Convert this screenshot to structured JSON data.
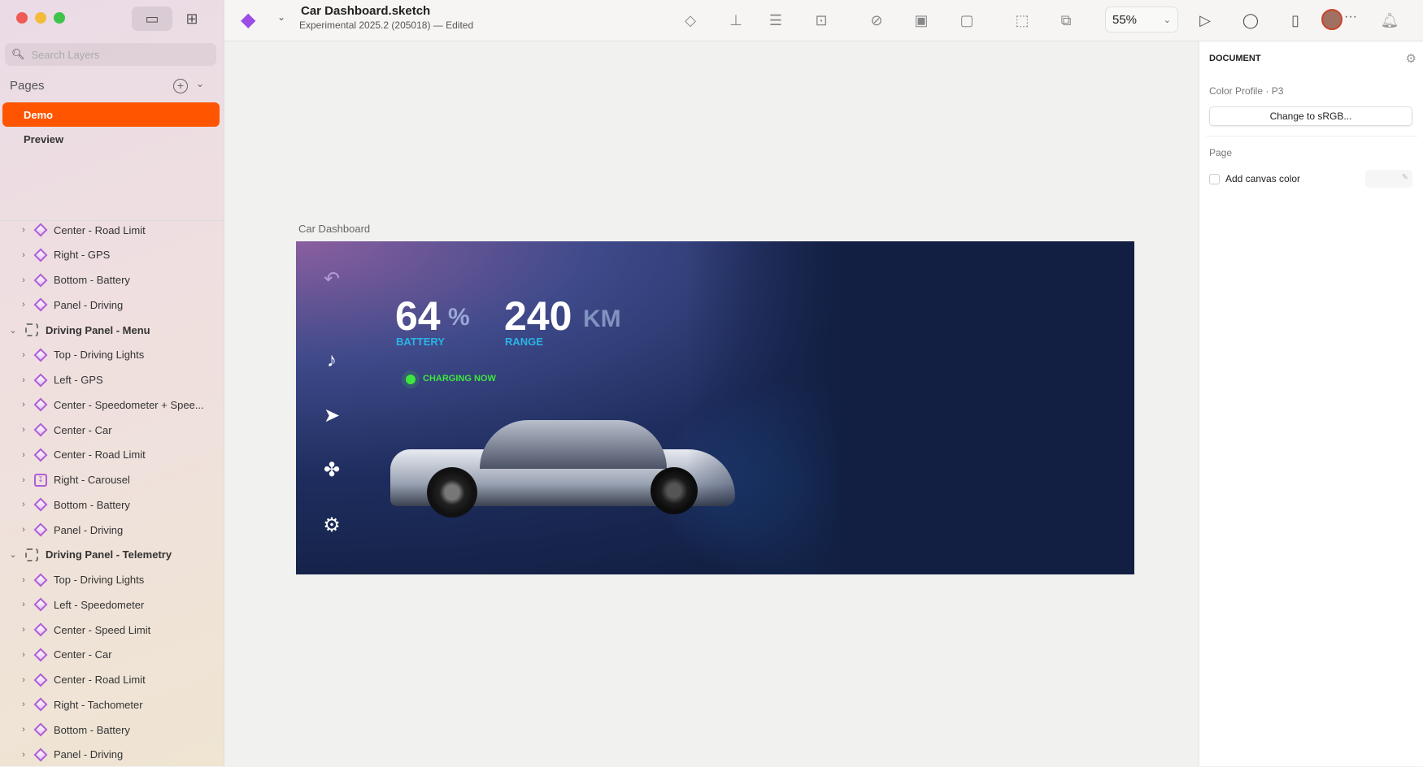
{
  "window": {
    "title": "Car Dashboard.sketch",
    "subtitle": "Experimental 2025.2 (205018) — Edited"
  },
  "sidebar": {
    "search_placeholder": "Search Layers",
    "pages_label": "Pages",
    "pages": [
      {
        "label": "Demo",
        "selected": true
      },
      {
        "label": "Preview",
        "selected": false
      }
    ],
    "layers": [
      {
        "label": "Center - Road Limit",
        "type": "symbol",
        "depth": 1
      },
      {
        "label": "Right - GPS",
        "type": "symbol",
        "depth": 1
      },
      {
        "label": "Bottom - Battery",
        "type": "symbol",
        "depth": 1
      },
      {
        "label": "Panel - Driving",
        "type": "symbol",
        "depth": 1
      },
      {
        "label": "Driving Panel - Menu",
        "type": "group",
        "depth": 0
      },
      {
        "label": "Top - Driving Lights",
        "type": "symbol",
        "depth": 1
      },
      {
        "label": "Left - GPS",
        "type": "symbol",
        "depth": 1
      },
      {
        "label": "Center - Speedometer + Spee...",
        "type": "symbol",
        "depth": 1
      },
      {
        "label": "Center - Car",
        "type": "symbol",
        "depth": 1
      },
      {
        "label": "Center - Road Limit",
        "type": "symbol",
        "depth": 1
      },
      {
        "label": "Right - Carousel",
        "type": "carousel",
        "depth": 1
      },
      {
        "label": "Bottom - Battery",
        "type": "symbol",
        "depth": 1
      },
      {
        "label": "Panel - Driving",
        "type": "symbol",
        "depth": 1
      },
      {
        "label": "Driving Panel - Telemetry",
        "type": "group",
        "depth": 0
      },
      {
        "label": "Top - Driving Lights",
        "type": "symbol",
        "depth": 1
      },
      {
        "label": "Left - Speedometer",
        "type": "symbol",
        "depth": 1
      },
      {
        "label": "Center - Speed Limit",
        "type": "symbol",
        "depth": 1
      },
      {
        "label": "Center - Car",
        "type": "symbol",
        "depth": 1
      },
      {
        "label": "Center - Road Limit",
        "type": "symbol",
        "depth": 1
      },
      {
        "label": "Right - Tachometer",
        "type": "symbol",
        "depth": 1
      },
      {
        "label": "Bottom - Battery",
        "type": "symbol",
        "depth": 1
      },
      {
        "label": "Panel - Driving",
        "type": "symbol",
        "depth": 1
      }
    ]
  },
  "toolbar": {
    "zoom": "55%"
  },
  "canvas": {
    "artboard_label": "Car Dashboard",
    "battery_value": "64",
    "battery_unit": "%",
    "battery_label": "BATTERY",
    "range_value": "240",
    "range_unit": "KM",
    "range_label": "RANGE",
    "charging": "CHARGING NOW"
  },
  "inspector": {
    "section": "DOCUMENT",
    "color_profile": "Color Profile · P3",
    "change_button": "Change to sRGB...",
    "page_label": "Page",
    "canvas_color": "Add canvas color"
  },
  "colors": {
    "accent": "#ff5500",
    "label_blue": "#2bb4e6",
    "charging_green": "#3ee63e"
  }
}
